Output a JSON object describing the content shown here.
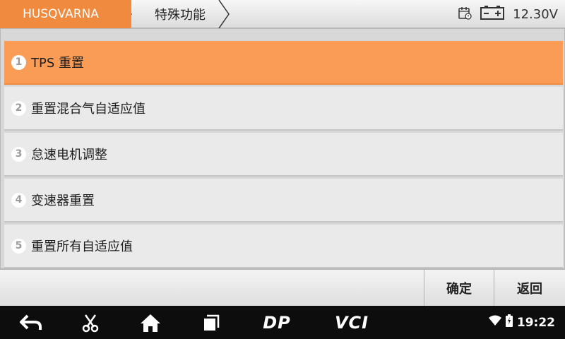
{
  "header": {
    "brand": "HUSQVARNA",
    "title": "特殊功能",
    "voltage": "12.30V"
  },
  "menu": {
    "items": [
      {
        "num": "1",
        "label": "TPS 重置"
      },
      {
        "num": "2",
        "label": "重置混合气自适应值"
      },
      {
        "num": "3",
        "label": "怠速电机调整"
      },
      {
        "num": "4",
        "label": "变速器重置"
      },
      {
        "num": "5",
        "label": "重置所有自适应值"
      }
    ],
    "selected_index": 0
  },
  "actions": {
    "confirm": "确定",
    "back": "返回"
  },
  "navbar": {
    "dp": "DP",
    "vci": "VCI",
    "time": "19:22"
  },
  "colors": {
    "accent": "#f08a3e",
    "selected_row": "#fb9c56"
  }
}
